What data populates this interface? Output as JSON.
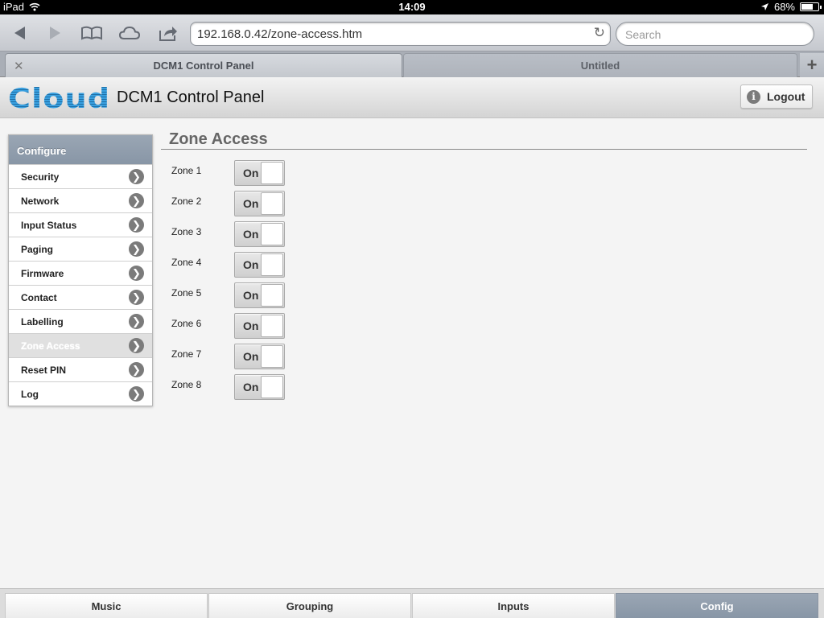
{
  "status_bar": {
    "device": "iPad",
    "time": "14:09",
    "battery": "68%",
    "battery_level": 0.68
  },
  "browser": {
    "url": "192.168.0.42/zone-access.htm",
    "search_placeholder": "Search",
    "tabs": [
      {
        "label": "DCM1 Control Panel",
        "active": true
      },
      {
        "label": "Untitled",
        "active": false
      }
    ],
    "toolbar_icons": [
      "back-icon",
      "forward-icon",
      "bookmarks-icon",
      "cloud-icon",
      "share-icon",
      "reload-icon"
    ]
  },
  "header": {
    "logo_text": "Cloud",
    "title": "DCM1 Control Panel",
    "logout_label": "Logout"
  },
  "sidebar": {
    "heading": "Configure",
    "items": [
      {
        "label": "Security",
        "active": false
      },
      {
        "label": "Network",
        "active": false
      },
      {
        "label": "Input Status",
        "active": false
      },
      {
        "label": "Paging",
        "active": false
      },
      {
        "label": "Firmware",
        "active": false
      },
      {
        "label": "Contact",
        "active": false
      },
      {
        "label": "Labelling",
        "active": false
      },
      {
        "label": "Zone Access",
        "active": true
      },
      {
        "label": "Reset PIN",
        "active": false
      },
      {
        "label": "Log",
        "active": false
      }
    ]
  },
  "main": {
    "title": "Zone Access",
    "zones": [
      {
        "label": "Zone 1",
        "state": "On"
      },
      {
        "label": "Zone 2",
        "state": "On"
      },
      {
        "label": "Zone 3",
        "state": "On"
      },
      {
        "label": "Zone 4",
        "state": "On"
      },
      {
        "label": "Zone 5",
        "state": "On"
      },
      {
        "label": "Zone 6",
        "state": "On"
      },
      {
        "label": "Zone 7",
        "state": "On"
      },
      {
        "label": "Zone 8",
        "state": "On"
      }
    ]
  },
  "bottom_nav": [
    {
      "label": "Music",
      "active": false
    },
    {
      "label": "Grouping",
      "active": false
    },
    {
      "label": "Inputs",
      "active": false
    },
    {
      "label": "Config",
      "active": true
    }
  ],
  "colors": {
    "accent": "#8896a6",
    "logo": "#2f8fce",
    "header_bg": "#e0e0e0"
  }
}
